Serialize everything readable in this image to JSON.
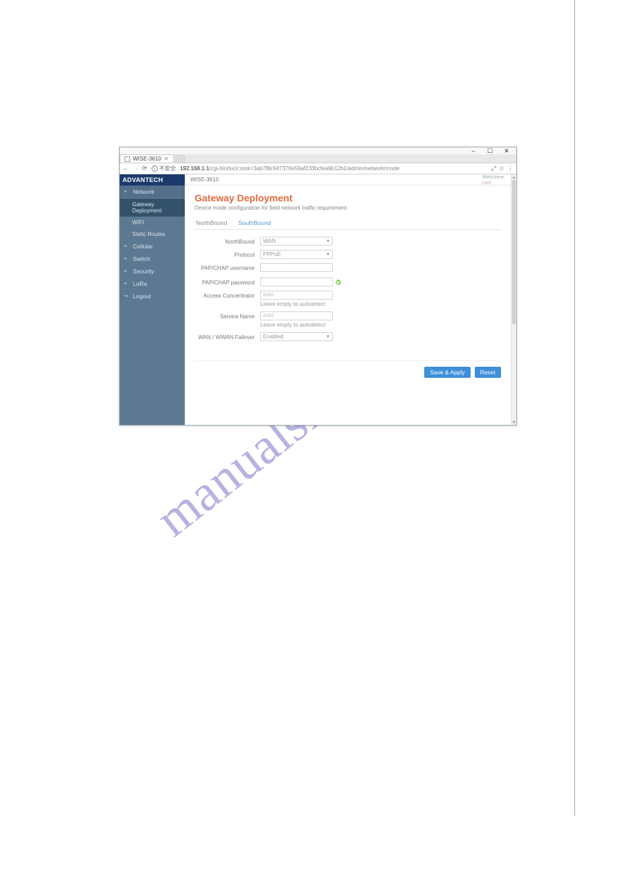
{
  "browser": {
    "tab_title": "WISE-3610",
    "security_label": "不安全",
    "url_host": "192.168.1.1",
    "url_rest": "/cgi-bin/luci/;stok=3ab7f8c947370e59af233bcfea9b12b1/admin/network/mode",
    "win_min": "–",
    "win_max": "☐",
    "win_close": "✕",
    "back": "←",
    "forward": "→",
    "reload": "⟳",
    "translate": "⤢",
    "star": "☆",
    "menu": "⋮",
    "tab_close": "✕",
    "info": "i"
  },
  "brand": "ADVANTECH",
  "device": "WISE-3610",
  "welcome": {
    "line1": "Welcome,",
    "line2": "root"
  },
  "sidebar": {
    "items": [
      {
        "icon": "≡",
        "label": "Network"
      },
      {
        "icon": "≡",
        "label": "Cellular"
      },
      {
        "icon": "≡",
        "label": "Switch"
      },
      {
        "icon": "≡",
        "label": "Security"
      },
      {
        "icon": "≡",
        "label": "LoRa"
      },
      {
        "icon": "↪",
        "label": "Logout"
      }
    ],
    "subitems": [
      {
        "label": "Gateway Deployment"
      },
      {
        "label": "WIFI"
      },
      {
        "label": "Static Routes"
      }
    ]
  },
  "page": {
    "title": "Gateway Deployment",
    "subtitle": "Device mode configuration for field network traffic requirement",
    "tabs": {
      "a": "NorthBound",
      "b": "SouthBound"
    }
  },
  "form": {
    "northbound": {
      "label": "NorthBound",
      "value": "WAN"
    },
    "protocol": {
      "label": "Protocol",
      "value": "PPPoE"
    },
    "papchap_user": {
      "label": "PAP/CHAP username",
      "value": ""
    },
    "papchap_pass": {
      "label": "PAP/CHAP password",
      "value": ""
    },
    "ac": {
      "label": "Access Concentrator",
      "placeholder": "auto",
      "hint": "Leave empty to autodetect"
    },
    "svc": {
      "label": "Service Name",
      "placeholder": "auto",
      "hint": "Leave empty to autodetect"
    },
    "failover": {
      "label": "WAN / WWAN Failover",
      "value": "Enabled"
    }
  },
  "actions": {
    "save": "Save & Apply",
    "reset": "Reset"
  },
  "watermark": "manualshive.com",
  "scrollbar": {
    "up": "▴",
    "down": "▾"
  }
}
